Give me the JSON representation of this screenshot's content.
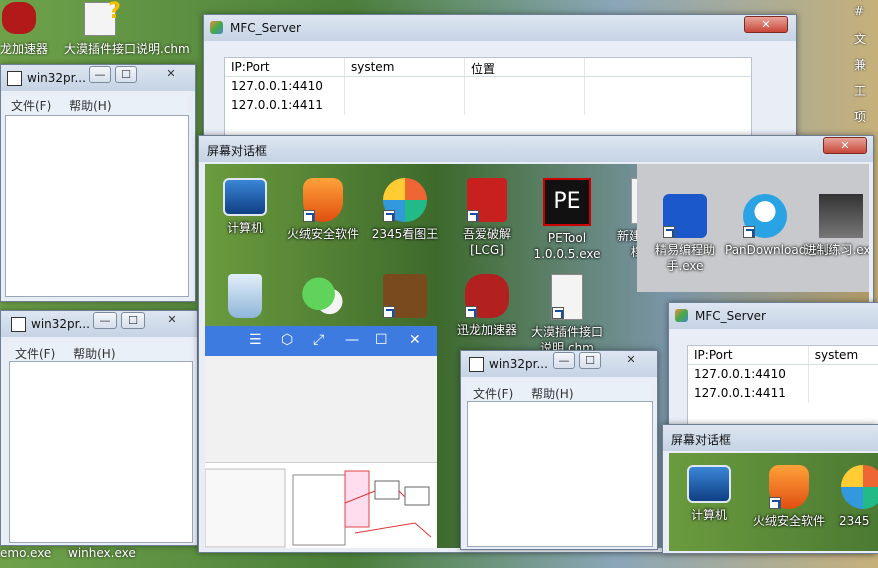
{
  "desktop_back": {
    "top_left": [
      "龙加速器",
      "大漠插件接口说明.chm"
    ],
    "bottom_left": [
      "emo.exe",
      "winhex.exe"
    ],
    "right_edge": [
      "#",
      "文",
      "兼",
      "工",
      "项"
    ]
  },
  "mfc_server_1": {
    "title": "MFC_Server",
    "close": "✕",
    "columns": [
      "IP:Port",
      "system",
      "位置"
    ],
    "rows": [
      [
        "127.0.0.1:4410",
        "",
        ""
      ],
      [
        "127.0.0.1:4411",
        "",
        ""
      ]
    ]
  },
  "win32_1": {
    "title": "win32pr...",
    "menu": [
      "文件(F)",
      "帮助(H)"
    ]
  },
  "win32_2": {
    "title": "win32pr...",
    "menu": [
      "文件(F)",
      "帮助(H)"
    ]
  },
  "screen_dialog": {
    "title": "屏幕对话框",
    "close": "✕",
    "icons": [
      "计算机",
      "火绒安全软件",
      "2345看图王",
      "吾爱破解[LCG]",
      "PETool 1.0.0.5.exe",
      "新建文本文档.txt"
    ],
    "icons_row2": [
      "",
      "",
      "",
      "迅龙加速器",
      "大漠插件接口说明.chm"
    ],
    "overlay_icons": [
      "精易编程助手.exe",
      "PanDownload.exe",
      "进制练习.exe"
    ],
    "inner_menu_glyphs": [
      "☰",
      "⬡",
      "⤢",
      "—",
      "☐",
      "✕"
    ]
  },
  "win32_3": {
    "title": "win32pr...",
    "menu": [
      "文件(F)",
      "帮助(H)"
    ]
  },
  "mfc_server_2": {
    "title": "MFC_Server",
    "columns": [
      "IP:Port",
      "system"
    ],
    "rows": [
      [
        "127.0.0.1:4410",
        ""
      ],
      [
        "127.0.0.1:4411",
        ""
      ]
    ]
  },
  "screen_dialog_2": {
    "title": "屏幕对话框",
    "icons": [
      "计算机",
      "火绒安全软件",
      "2345"
    ]
  },
  "colors": {
    "accent_blue": "#3e7be0",
    "titlebar": "#c9d6e6",
    "close_red": "#c8473a"
  }
}
